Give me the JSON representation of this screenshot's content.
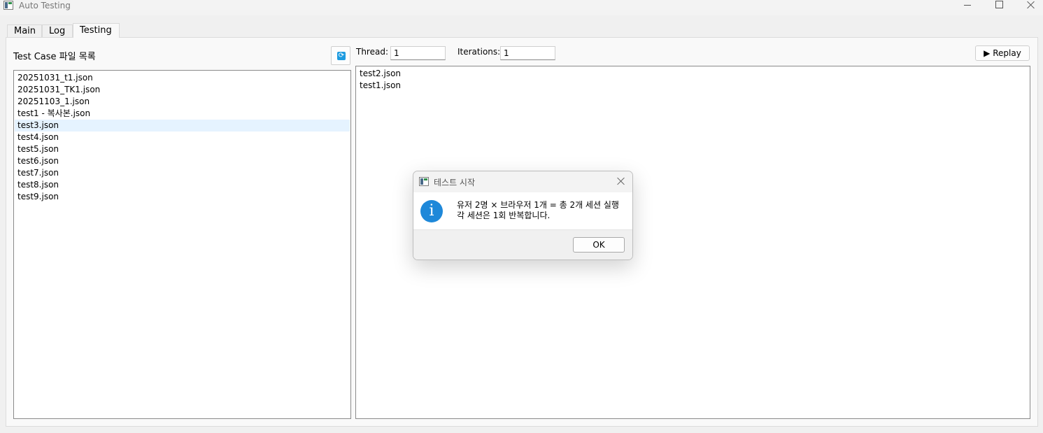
{
  "window": {
    "title": "Auto Testing"
  },
  "tabs": [
    {
      "label": "Main"
    },
    {
      "label": "Log"
    },
    {
      "label": "Testing"
    }
  ],
  "left_panel": {
    "title": "Test Case 파일 목록",
    "refresh_icon": "refresh-icon",
    "files": [
      "20251031_t1.json",
      "20251031_TK1.json",
      "20251103_1.json",
      "test1 - 복사본.json",
      "test3.json",
      "test4.json",
      "test5.json",
      "test6.json",
      "test7.json",
      "test8.json",
      "test9.json"
    ],
    "selected_file": "test3.json"
  },
  "controls": {
    "thread_label": "Thread:",
    "thread_value": "1",
    "iterations_label": "Iterations:",
    "iterations_value": "1",
    "replay_label": "▶ Replay"
  },
  "queue": {
    "files": [
      "test2.json",
      "test1.json"
    ]
  },
  "dialog": {
    "title": "테스트 시작",
    "icon": "info-icon",
    "message_line1": "유저 2명 × 브라우저 1개 = 총 2개 세션 실행",
    "message_line2": "각 세션은 1회 반복합니다.",
    "ok_label": "OK"
  },
  "colors": {
    "accent": "#1e88d9",
    "selection": "#e5f3ff"
  }
}
